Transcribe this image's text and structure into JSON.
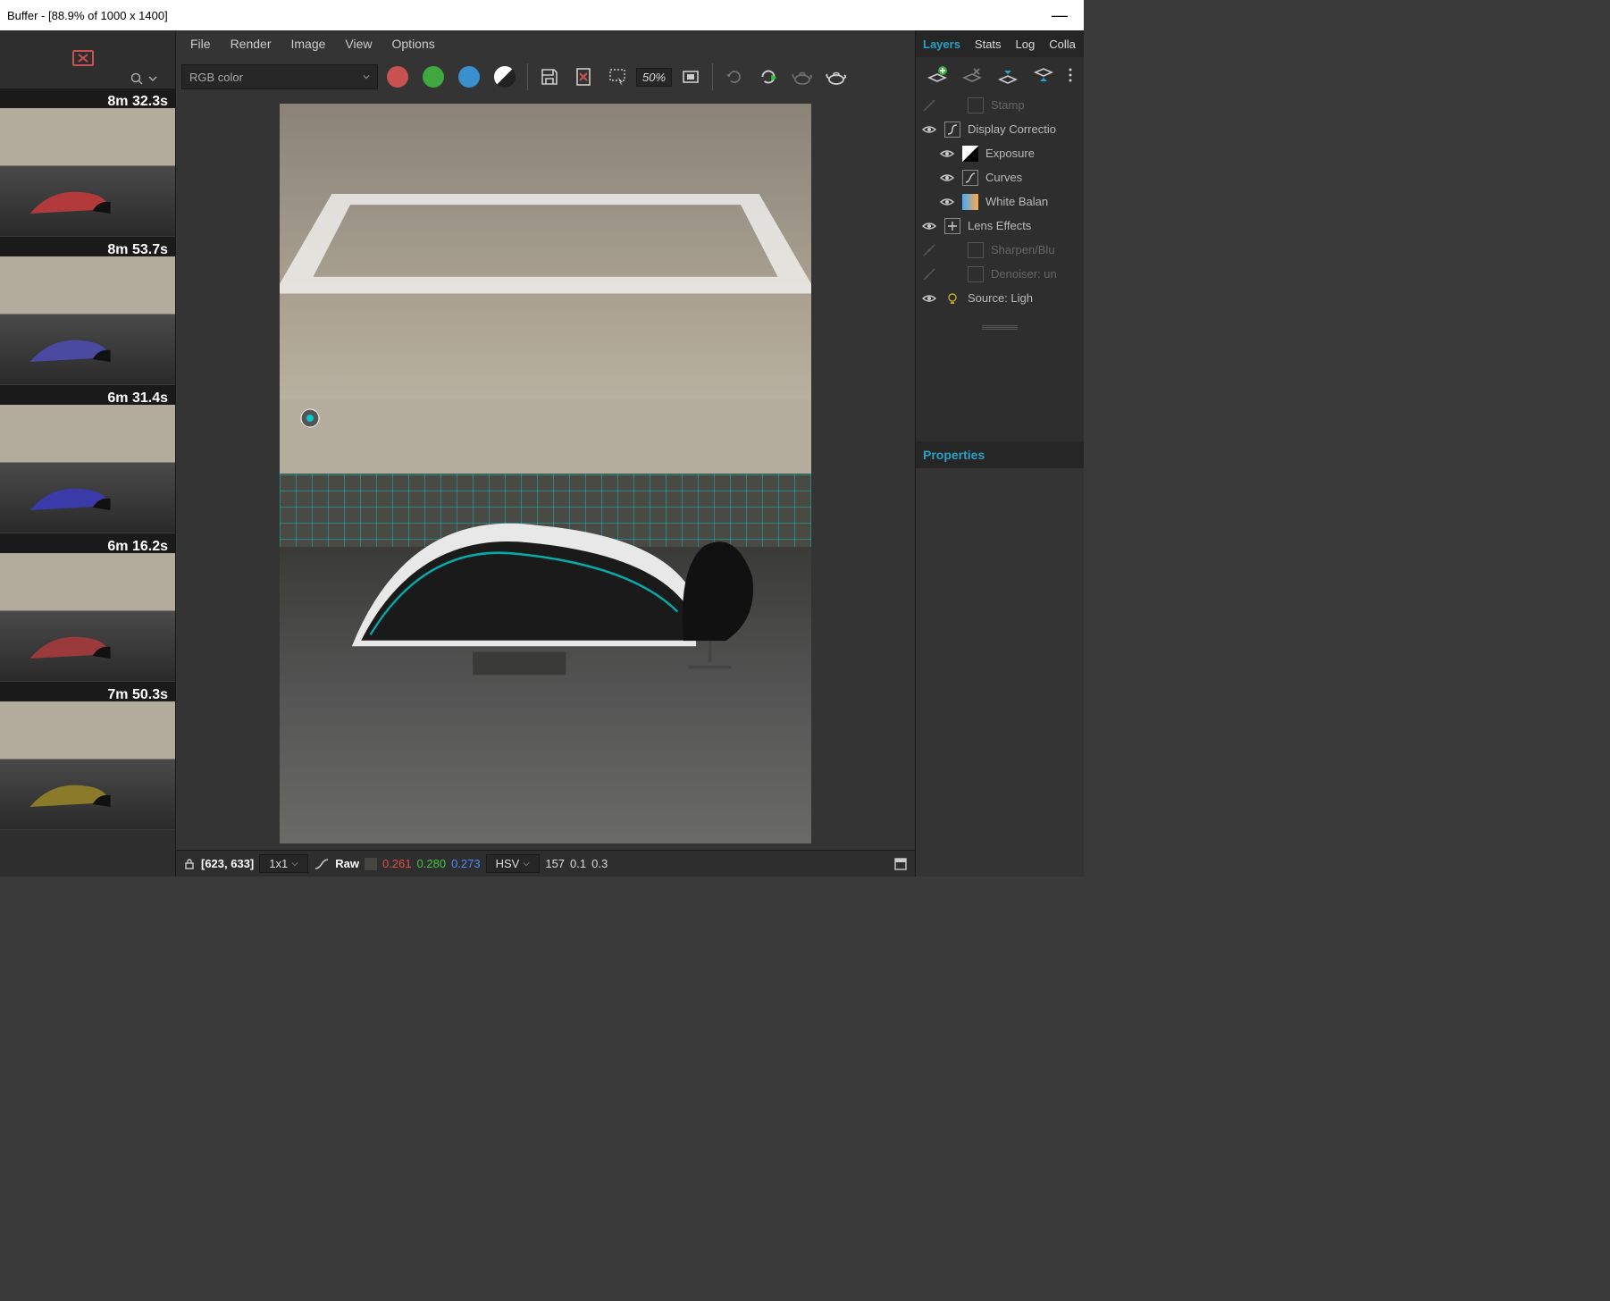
{
  "window": {
    "title": "Buffer - [88.9% of 1000 x 1400]",
    "minimize": "—"
  },
  "menu": {
    "file": "File",
    "render": "Render",
    "image": "Image",
    "view": "View",
    "options": "Options"
  },
  "toolbar": {
    "color_mode": "RGB color",
    "zoom_pill": "50%",
    "dot_colors": {
      "red": "#c85252",
      "green": "#3fa83f",
      "blue": "#3a8fcf"
    }
  },
  "history": {
    "items": [
      {
        "time": "8m 32.3s",
        "accent": "#b33a3a"
      },
      {
        "time": "8m 53.7s",
        "accent": "#4a4aa0"
      },
      {
        "time": "6m 31.4s",
        "accent": "#3a3aa8"
      },
      {
        "time": "6m 16.2s",
        "accent": "#9a3a3a"
      },
      {
        "time": "7m 50.3s",
        "accent": "#8a7a2a"
      }
    ]
  },
  "layers": {
    "tabs": {
      "layers": "Layers",
      "stats": "Stats",
      "log": "Log",
      "collab": "Colla"
    },
    "list": [
      {
        "visible": false,
        "label": "Stamp",
        "dim": true
      },
      {
        "visible": true,
        "label": "Display Correctio"
      },
      {
        "visible": true,
        "label": "Exposure"
      },
      {
        "visible": true,
        "label": "Curves"
      },
      {
        "visible": true,
        "label": "White Balan"
      },
      {
        "visible": true,
        "label": "Lens Effects"
      },
      {
        "visible": false,
        "label": "Sharpen/Blu",
        "dim": true
      },
      {
        "visible": false,
        "label": "Denoiser: un",
        "dim": true
      },
      {
        "visible": true,
        "label": "Source: Ligh"
      }
    ]
  },
  "properties": {
    "title": "Properties"
  },
  "status": {
    "lock": "🔒",
    "coords": "[623, 633]",
    "pixel_size": "1x1",
    "raw": "Raw",
    "rgb": {
      "r": "0.261",
      "g": "0.280",
      "b": "0.273"
    },
    "hsv_label": "HSV",
    "hsv": {
      "h": "157",
      "s": "0.1",
      "v": "0.3"
    }
  }
}
